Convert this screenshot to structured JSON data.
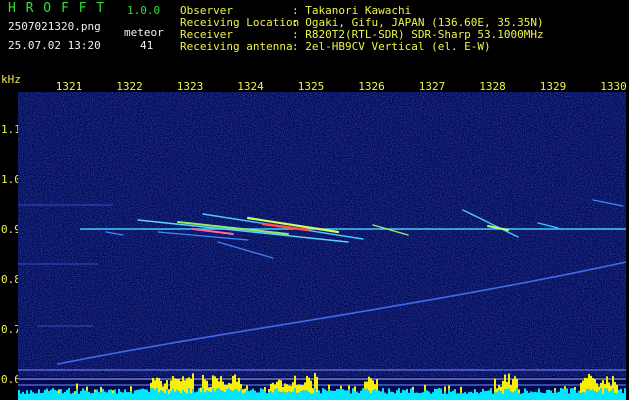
{
  "header": {
    "app_name": "H R O F F T",
    "version": "1.0.0",
    "filename": "2507021320.png",
    "datetime": "25.07.02 13:20",
    "meteor_label": "meteor",
    "meteor_count": "41"
  },
  "info": {
    "observer_label": "Observer",
    "observer_value": ": Takanori Kawachi",
    "location_label": "Receiving Location",
    "location_value": ": Ogaki, Gifu, JAPAN (136.60E, 35.35N)",
    "receiver_label": "Receiver",
    "receiver_value": ": R820T2(RTL-SDR) SDR-Sharp 53.1000MHz",
    "antenna_label": "Receiving antenna",
    "antenna_value": ": 2el-HB9CV Vertical (el. E-W)"
  },
  "axis": {
    "unit": "kHz",
    "x_ticks": [
      "1321",
      "1322",
      "1323",
      "1324",
      "1325",
      "1326",
      "1327",
      "1328",
      "1329",
      "1330"
    ],
    "y_ticks": [
      "1.1",
      "1.0",
      "0.9",
      "0.8",
      "0.7",
      "0.6"
    ]
  },
  "colors": {
    "background": "#000000",
    "spectrum_bg": "#000a50",
    "carrier": "#46c8ff",
    "histogram_cyan": "#00e8ff",
    "histogram_yellow": "#f8f000",
    "label_yellow": "#f2f24a",
    "label_green": "#2fe02f"
  }
}
